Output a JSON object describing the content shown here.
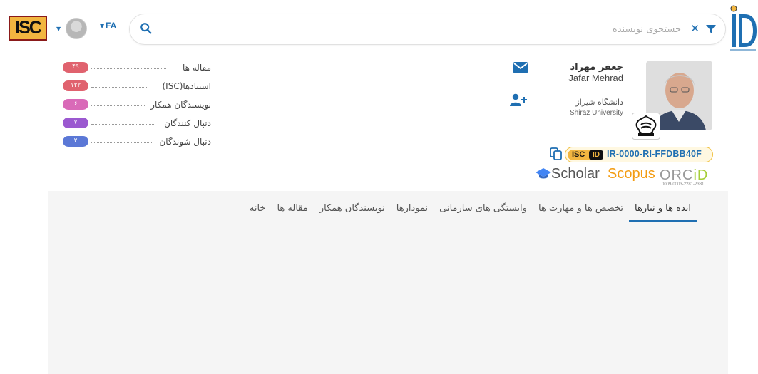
{
  "header": {
    "isc_logo_text": "ISC",
    "language": "FA",
    "search": {
      "placeholder": "جستجوی نویسنده",
      "value": ""
    }
  },
  "stats": [
    {
      "label": "مقاله ها",
      "count": "۴۹",
      "color": "#e0626e"
    },
    {
      "label": "استنادها(ISC)",
      "count": "۱۲۲",
      "color": "#e0626e"
    },
    {
      "label": "نویسندگان همکار",
      "count": "۶",
      "color": "#d96ab8"
    },
    {
      "label": "دنبال کنندگان",
      "count": "۷",
      "color": "#9b59d0"
    },
    {
      "label": "دنبال شوندگان",
      "count": "۲",
      "color": "#5b78d6"
    }
  ],
  "profile": {
    "name_fa": "جعفر مهراد",
    "name_en": "Jafar Mehrad",
    "affiliation_fa": "دانشگاه شیراز",
    "affiliation_en": "Shiraz University",
    "isc_badge_isc": "ISC",
    "isc_badge_id": "ID",
    "isc_id": "IR-0000-RI-FFDBB40F",
    "scholar_label": "Scholar",
    "scopus_label": "Scopus",
    "orcid_label_main": "ORC",
    "orcid_label_accent": "iD",
    "orcid_number": "0009-0003-2281-2331"
  },
  "tabs": [
    {
      "label": "خانه",
      "active": false
    },
    {
      "label": "مقاله ها",
      "active": false
    },
    {
      "label": "نویسندگان همکار",
      "active": false
    },
    {
      "label": "نمودارها",
      "active": false
    },
    {
      "label": "وابستگی های سازمانی",
      "active": false
    },
    {
      "label": "تخصص ها و مهارت ها",
      "active": false
    },
    {
      "label": "ایده ها و نیازها",
      "active": true
    }
  ],
  "colors": {
    "accent": "#1f6fb2",
    "scopus": "#f39c12",
    "orcid_accent": "#a6ce39",
    "isc_gold": "#f2b640"
  }
}
